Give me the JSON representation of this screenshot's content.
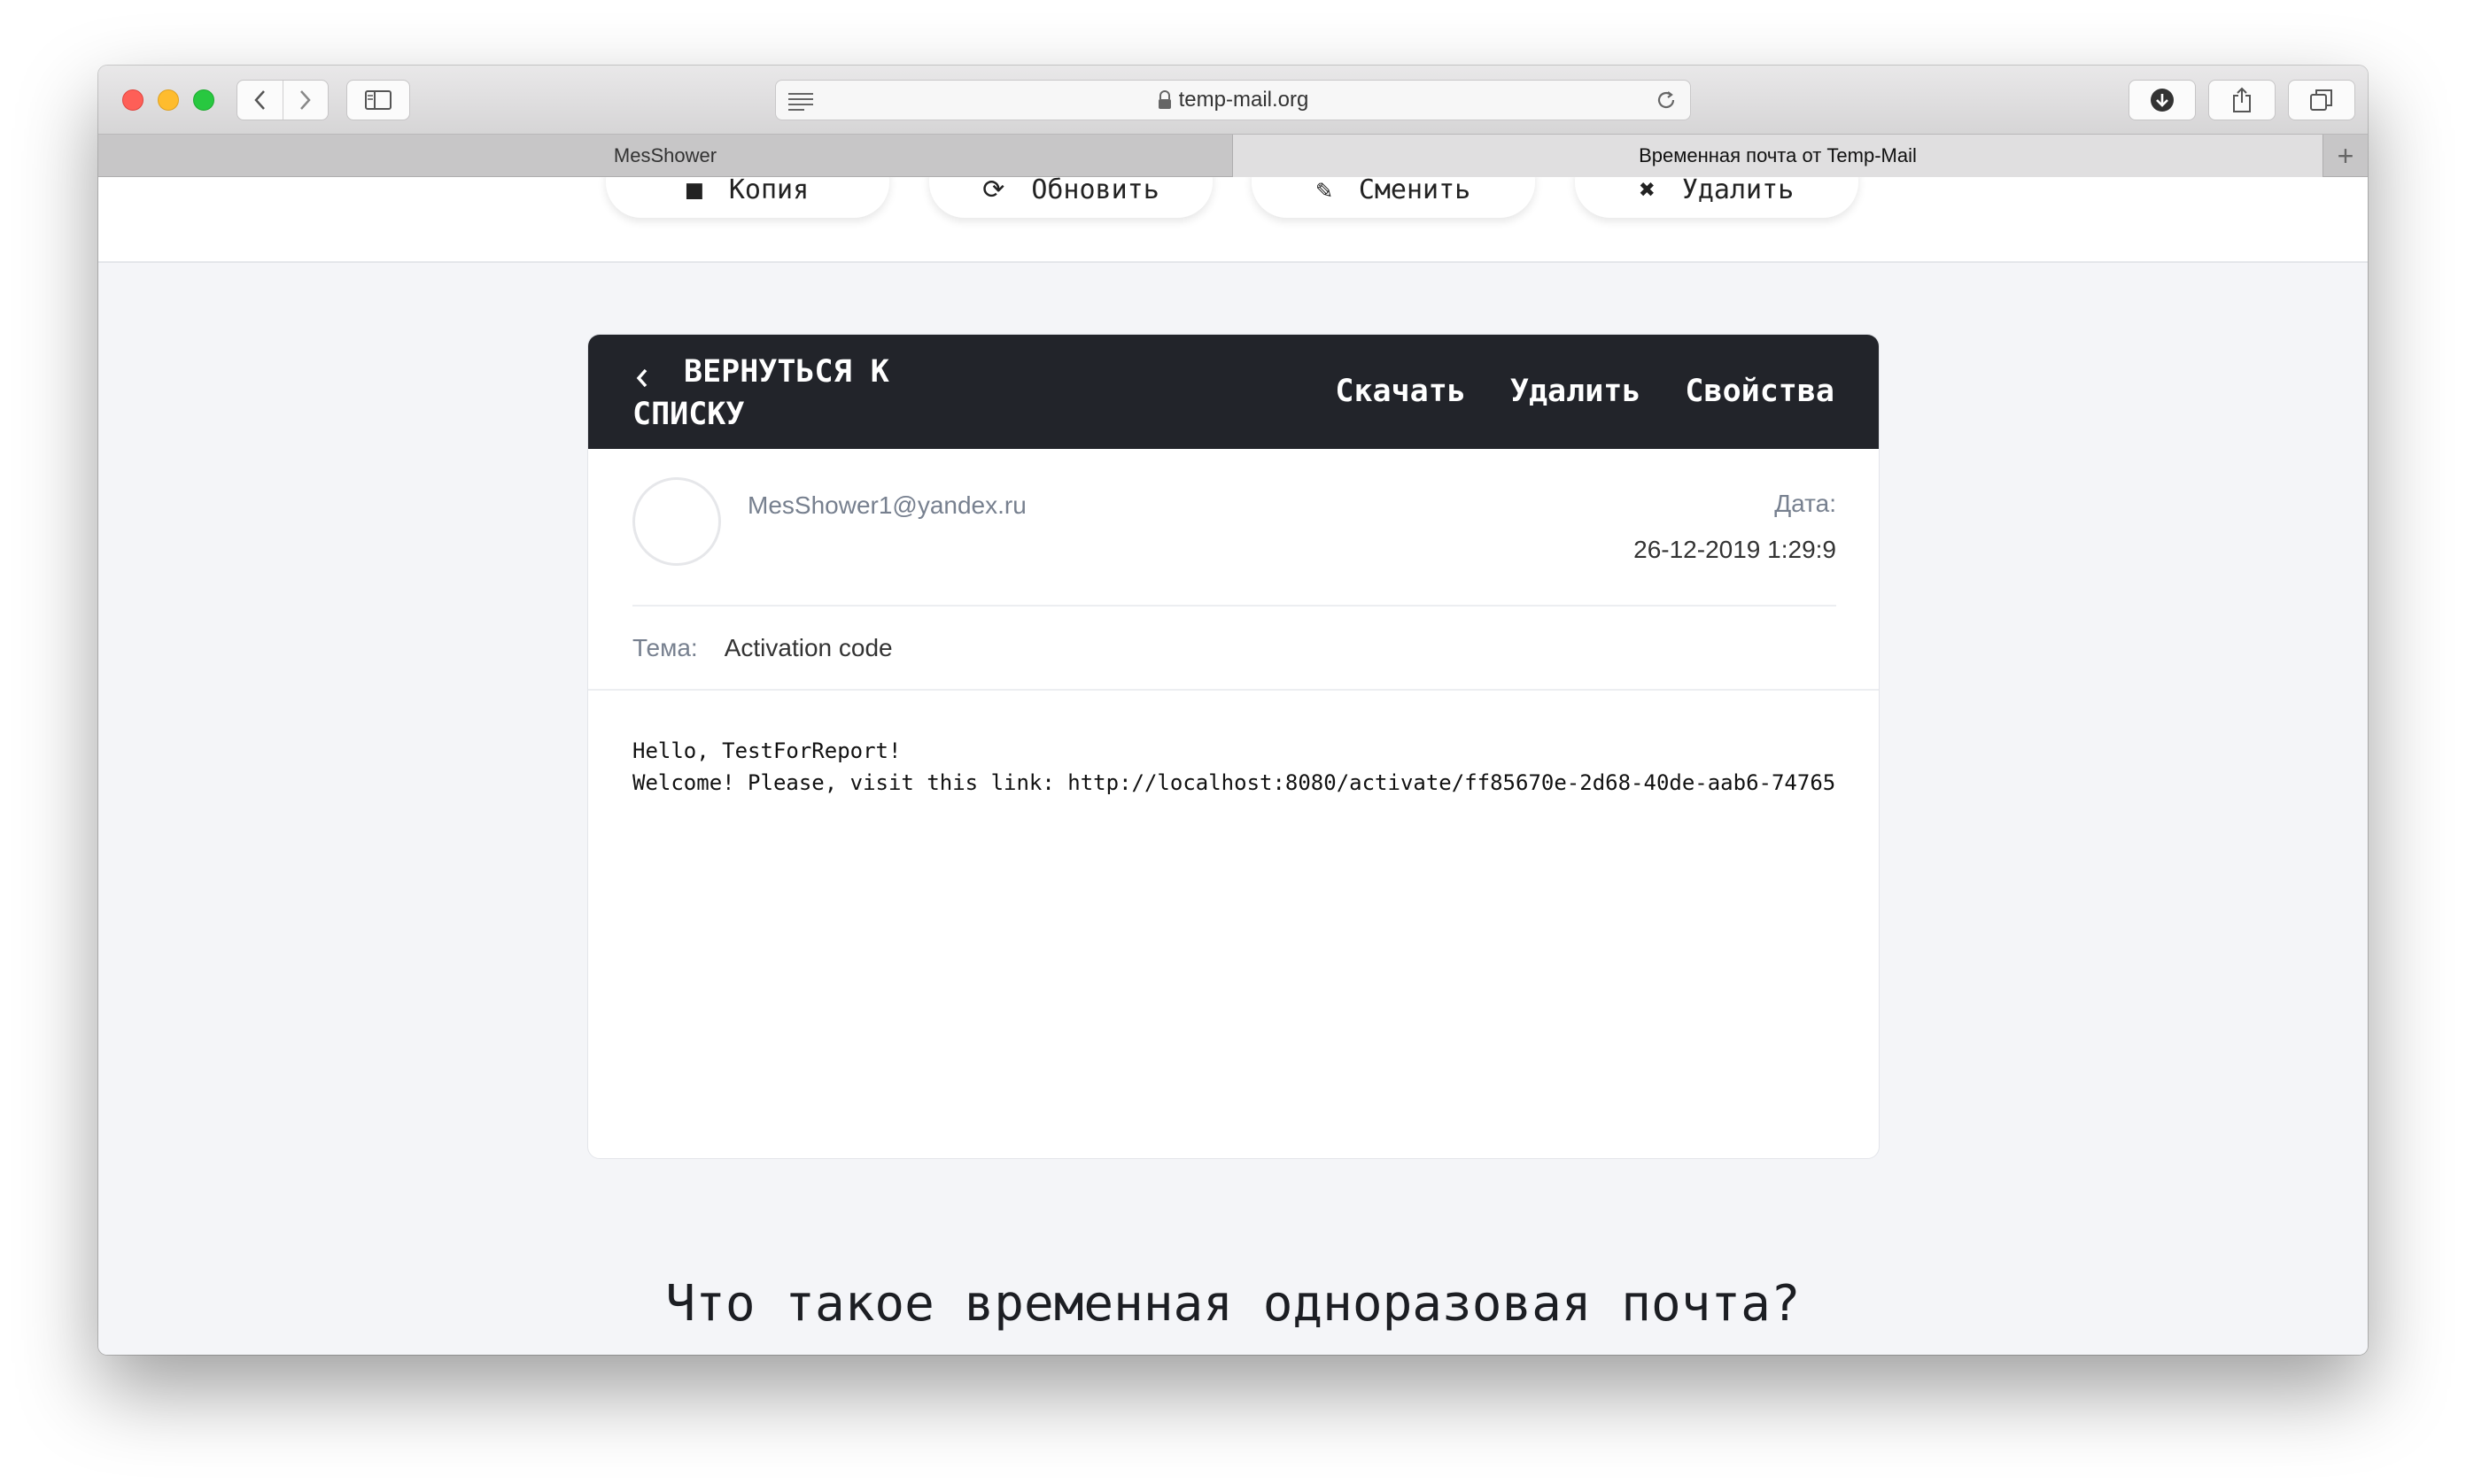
{
  "browser": {
    "address": "temp-mail.org",
    "tabs": [
      {
        "label": "MesShower"
      },
      {
        "label": "Временная почта от Temp-Mail"
      }
    ],
    "new_tab_label": "+"
  },
  "toolbar_pills": [
    {
      "label": "Копия",
      "icon": "copy-icon"
    },
    {
      "label": "Обновить",
      "icon": "refresh-icon"
    },
    {
      "label": "Сменить",
      "icon": "edit-icon"
    },
    {
      "label": "Удалить",
      "icon": "close-icon"
    }
  ],
  "message": {
    "back_label_line1": "ВЕРНУТЬСЯ К",
    "back_label_line2": "СПИСКУ",
    "actions": {
      "download": "Скачать",
      "delete": "Удалить",
      "properties": "Свойства"
    },
    "sender": "MesShower1@yandex.ru",
    "date_label": "Дата:",
    "date_value": "26-12-2019 1:29:9",
    "subject_label": "Тема:",
    "subject_value": "Activation code",
    "body_line1": "Hello, TestForReport!",
    "body_line2": "Welcome! Please, visit this link: http://localhost:8080/activate/ff85670e-2d68-40de-aab6-74765"
  },
  "faq_heading": "Что такое временная одноразовая почта?"
}
